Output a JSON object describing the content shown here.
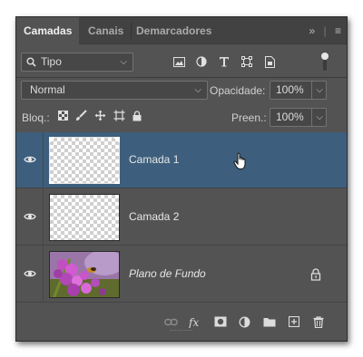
{
  "tabs": [
    {
      "label": "Camadas",
      "active": true
    },
    {
      "label": "Canais",
      "active": false
    },
    {
      "label": "Demarcadores",
      "active": false
    }
  ],
  "tab_icons": {
    "collapse": "»",
    "menu": "≡"
  },
  "filter": {
    "kind_value": "Tipo",
    "kind_icon": "search-icon",
    "icons": [
      "pixel-filter-icon",
      "adjustment-filter-icon",
      "type-filter-icon",
      "shape-filter-icon",
      "smart-object-filter-icon"
    ]
  },
  "blend": {
    "mode": "Normal",
    "opacity_label": "Opacidade:",
    "opacity_value": "100%"
  },
  "lock": {
    "label": "Bloq.:",
    "fill_label": "Preen.:",
    "fill_value": "100%"
  },
  "layers": [
    {
      "name": "Camada 1",
      "selected": true,
      "visible": true,
      "locked": false,
      "italic": false
    },
    {
      "name": "Camada 2",
      "selected": false,
      "visible": true,
      "locked": false,
      "italic": false
    },
    {
      "name": "Plano de Fundo",
      "selected": false,
      "visible": true,
      "locked": true,
      "italic": true
    }
  ],
  "bottom_icons": [
    "link-layers-icon",
    "fx-icon",
    "add-mask-icon",
    "adjustment-layer-icon",
    "new-group-icon",
    "new-layer-icon",
    "delete-layer-icon"
  ],
  "colors": {
    "panel": "#535353",
    "selection": "#3d5f7d",
    "tabbar": "#424242"
  }
}
